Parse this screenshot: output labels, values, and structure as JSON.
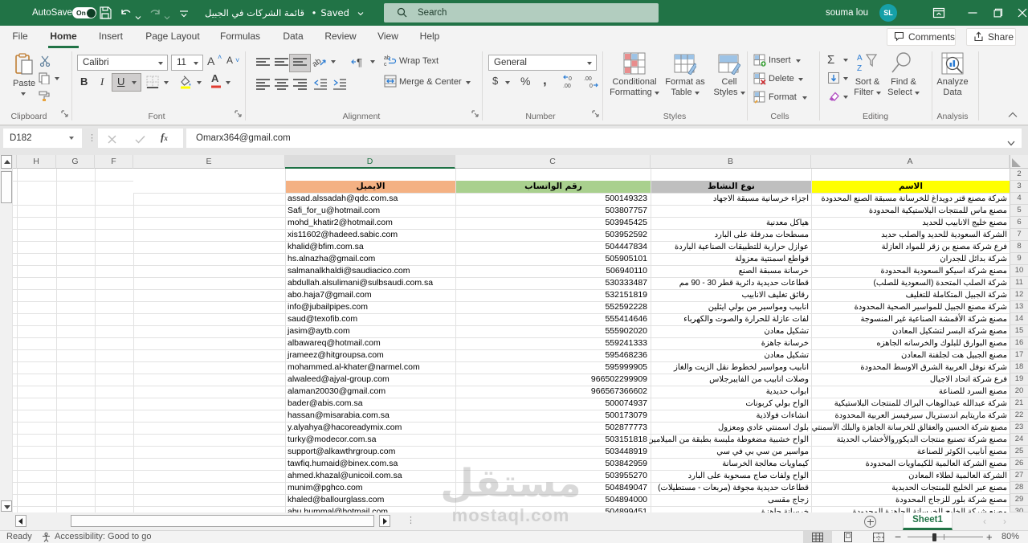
{
  "title_bar": {
    "autosave_label": "AutoSave",
    "autosave_state": "On",
    "document_title": "قائمة الشركات في الجبيل",
    "saved_separator": "•",
    "saved_status": "Saved",
    "search_placeholder": "Search",
    "user_name": "souma lou",
    "user_initials": "SL"
  },
  "ribbon_tabs": {
    "items": [
      "File",
      "Home",
      "Insert",
      "Page Layout",
      "Formulas",
      "Data",
      "Review",
      "View",
      "Help"
    ],
    "active": "Home",
    "comments_label": "Comments",
    "share_label": "Share"
  },
  "ribbon": {
    "clipboard": {
      "label": "Clipboard",
      "paste": "Paste"
    },
    "font": {
      "label": "Font",
      "font_name": "Calibri",
      "font_size": "11",
      "bold": "B",
      "italic": "I",
      "underline": "U"
    },
    "alignment": {
      "label": "Alignment",
      "wrap_text": "Wrap Text",
      "merge_center": "Merge & Center"
    },
    "number": {
      "label": "Number",
      "format": "General",
      "dollar": "$",
      "percent": "%",
      "comma": ","
    },
    "styles": {
      "label": "Styles",
      "conditional_1": "Conditional",
      "conditional_2": "Formatting",
      "format_table_1": "Format as",
      "format_table_2": "Table",
      "cell_styles_1": "Cell",
      "cell_styles_2": "Styles"
    },
    "cells": {
      "label": "Cells",
      "insert": "Insert",
      "delete": "Delete",
      "format": "Format"
    },
    "editing": {
      "label": "Editing",
      "sort_filter_1": "Sort &",
      "sort_filter_2": "Filter",
      "find_select_1": "Find &",
      "find_select_2": "Select"
    },
    "analysis": {
      "label": "Analysis",
      "analyze_1": "Analyze",
      "analyze_2": "Data"
    }
  },
  "formula_bar": {
    "name_box": "D182",
    "fx": "fx",
    "value": "Omarx364@gmail.com"
  },
  "sheet": {
    "columns": [
      "H",
      "G",
      "F",
      "E",
      "D",
      "C",
      "B",
      "A"
    ],
    "selected_column": "D",
    "header_row": {
      "row": 3,
      "email": {
        "text": "الايميل",
        "color": "#F4B183"
      },
      "phone": {
        "text": "رقم الواتساب",
        "color": "#A9D08E"
      },
      "activity": {
        "text": "نوع النشاط",
        "color": "#BFBFBF"
      },
      "name": {
        "text": "الاسم",
        "color": "#FFFF00"
      }
    },
    "rows": [
      {
        "row": 4,
        "email": "assad.alssadah@qdc.com.sa",
        "phone": "500149323",
        "activity": "اجزاء خرسانية مسبقة الاجهاد",
        "name": "شركة مصنع قتر دويداغ للخرسانة مسبقة الصنع المحدودة"
      },
      {
        "row": 5,
        "email": "Safi_for_u@hotmail.com",
        "phone": "503807757",
        "activity": "",
        "name": "مصنع ماس للمنتجات البلاستيكية المحدودة"
      },
      {
        "row": 6,
        "email": "mohd_khatir2@hotmail.com",
        "phone": "503945425",
        "activity": "هياكل معدنية",
        "name": "مصنع خليج الانابيب للحديد"
      },
      {
        "row": 7,
        "email": "xis11602@hadeed.sabic.com",
        "phone": "503952592",
        "activity": "مسطحات مدرفلة على البارد",
        "name": "الشركة السعودية للحديد والصلب حديد"
      },
      {
        "row": 8,
        "email": "khalid@bfim.com.sa",
        "phone": "504447834",
        "activity": "عوازل حرارية للتطبيقات الصناعية الباردة",
        "name": "فرع شركة مصنع بن زقر للمواد العازلة"
      },
      {
        "row": 9,
        "email": "hs.alnazha@gmail.com",
        "phone": "505905101",
        "activity": "قواطع اسمنتية معزولة",
        "name": "شركة بدائل للجدران"
      },
      {
        "row": 10,
        "email": "salmanalkhaldi@saudiacico.com",
        "phone": "506940110",
        "activity": "خرسانة مسبقة الصنع",
        "name": "مصنع شركة اسيكو السعودية المحدودة"
      },
      {
        "row": 11,
        "email": "abdullah.alsulimani@sulbsaudi.com.sa",
        "phone": "530333487",
        "activity": "قطاعات حديدية دائرية قطر 30 - 90 مم",
        "name": "شركة الصلب المتحدة (السعودية للصلب)"
      },
      {
        "row": 12,
        "email": "abo.haja7@gmail.com",
        "phone": "532151819",
        "activity": "رقائق تغليف الانابيب",
        "name": "شركة الجبيل المتكاملة للتغليف"
      },
      {
        "row": 13,
        "email": "info@jubailpipes.com",
        "phone": "552592228",
        "activity": "انابيب ومواسير من بولي ايثلين",
        "name": "شركة مصنع الجبيل للمواسير الصحية المحدودة"
      },
      {
        "row": 14,
        "email": "saud@texofib.com",
        "phone": "555414646",
        "activity": "لفات عازلة للحرارة والصوت والكهرباء",
        "name": "مصنع شركة الأقمشة الصناعية غير المنسوجة"
      },
      {
        "row": 15,
        "email": "jasim@aytb.com",
        "phone": "555902020",
        "activity": "تشكيل معادن",
        "name": "مصنع شركة البسر لتشكيل المعادن"
      },
      {
        "row": 16,
        "email": "albawareq@hotmail.com",
        "phone": "559241333",
        "activity": "خرسانة جاهزة",
        "name": "مصنع البوارق للبلوك والخرسانه الجاهزه"
      },
      {
        "row": 17,
        "email": "jrameez@hitgroupsa.com",
        "phone": "595468236",
        "activity": "تشكيل معادن",
        "name": "مصنع الجبيل هت لجلفنة المعادن"
      },
      {
        "row": 18,
        "email": "mohammed.al-khater@narmel.com",
        "phone": "595999905",
        "activity": "انابيب ومواسير لخطوط نقل الزيت والغاز",
        "name": "شركة نوفل العربية الشرق الاوسط المحدودة"
      },
      {
        "row": 19,
        "email": "alwaleed@ajyal-group.com",
        "phone": "966502299909",
        "activity": "وصلات انابيب من الفايبرجلاس",
        "name": "فرع شركة اتحاد الاجيال"
      },
      {
        "row": 20,
        "email": "alaman20030@gmail.com",
        "phone": "966567366602",
        "activity": "ابواب حديدية",
        "name": "مصنع السرد للصناعة"
      },
      {
        "row": 21,
        "email": "bader@abis.com.sa",
        "phone": "500074937",
        "activity": "الواح بولي كربونات",
        "name": "شركة عبدالله عبدالوهاب البراك للمنتجات البلاستيكية"
      },
      {
        "row": 22,
        "email": "hassan@misarabia.com.sa",
        "phone": "500173079",
        "activity": "انشاءات فولاذية",
        "name": "شركة ماريتايم اندستريال سيرفيسز العربية المحدودة"
      },
      {
        "row": 23,
        "email": "y.alyahya@hacoreadymix.com",
        "phone": "502877773",
        "activity": "بلوك اسمنتي عادي ومعزول",
        "name": "مصنع شركة الحسين والعفالق للخرسانة الجاهزة والبلك الأسمنتي"
      },
      {
        "row": 24,
        "email": "turky@modecor.com.sa",
        "phone": "503151818",
        "activity": "الواح خشبية مضغوطة ملبسة بطبقة من الميلامين او ال",
        "name": "مصنع شركة تصنيع منتجات الديكوروالأخشاب الحديثة"
      },
      {
        "row": 25,
        "email": "support@alkawthrgroup.com",
        "phone": "503448919",
        "activity": "مواسير من سي بي في سي",
        "name": "مصنع أنابيب الكوثر للصناعة"
      },
      {
        "row": 26,
        "email": "tawfiq.humaid@binex.com.sa",
        "phone": "503842959",
        "activity": "كيماويات معالجة الخرسانة",
        "name": "مصنع الشركة العالمية للكيماويات المحدودة"
      },
      {
        "row": 27,
        "email": "ahmed.khazal@unicoil.com.sa",
        "phone": "503955270",
        "activity": "الواح ولفات صاج مسحوبة على البارد",
        "name": "الشركة العالمية لطلاء المعادن"
      },
      {
        "row": 28,
        "email": "munim@pghco.com",
        "phone": "504849047",
        "activity": "قطاعات حديدية مجوفة (مربعات - مستطيلات)",
        "name": "مصنع عبر الخليج للمنتجات الحديدية"
      },
      {
        "row": 29,
        "email": "khaled@ballourglass.com",
        "phone": "504894000",
        "activity": "زجاج مقسى",
        "name": "مصنع شركة بلور للزجاج المحدودة"
      },
      {
        "row": 30,
        "email": "abu.hummal@hotmail.com",
        "phone": "504899451",
        "activity": "خرسانة جاهزة",
        "name": "مصنع شركة الخليج للخرسانة الجاهزة المحدودة"
      }
    ]
  },
  "watermark": {
    "line1": "مستقل",
    "line2": "mostaql.com"
  },
  "sheet_tabs": {
    "active": "Sheet1"
  },
  "status_bar": {
    "ready": "Ready",
    "accessibility": "Accessibility: Good to go",
    "zoom": "80%"
  },
  "colors": {
    "accent_green": "#217346",
    "header_email": "#F4B183",
    "header_phone": "#A9D08E",
    "header_activity": "#BFBFBF",
    "header_name": "#FFFF00"
  }
}
